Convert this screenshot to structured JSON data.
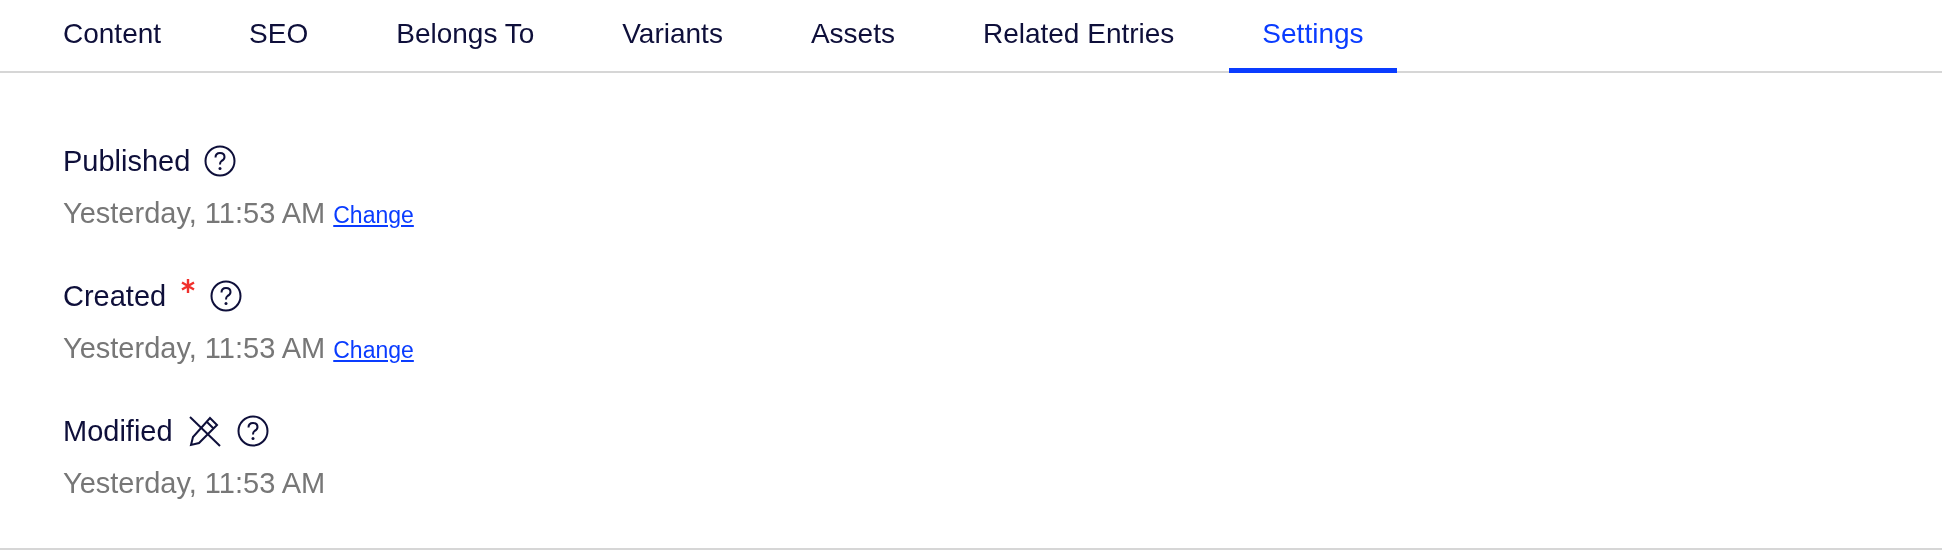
{
  "tabs": [
    {
      "label": "Content",
      "selected": false
    },
    {
      "label": "SEO",
      "selected": false
    },
    {
      "label": "Belongs To",
      "selected": false
    },
    {
      "label": "Variants",
      "selected": false
    },
    {
      "label": "Assets",
      "selected": false
    },
    {
      "label": "Related Entries",
      "selected": false
    },
    {
      "label": "Settings",
      "selected": true
    }
  ],
  "fields": [
    {
      "label": "Published",
      "required": false,
      "read_only": false,
      "value": "Yesterday, 11:53 AM",
      "action": "Change"
    },
    {
      "label": "Created",
      "required": true,
      "read_only": false,
      "value": "Yesterday, 11:53 AM",
      "action": "Change"
    },
    {
      "label": "Modified",
      "required": false,
      "read_only": true,
      "value": "Yesterday, 11:53 AM"
    }
  ]
}
